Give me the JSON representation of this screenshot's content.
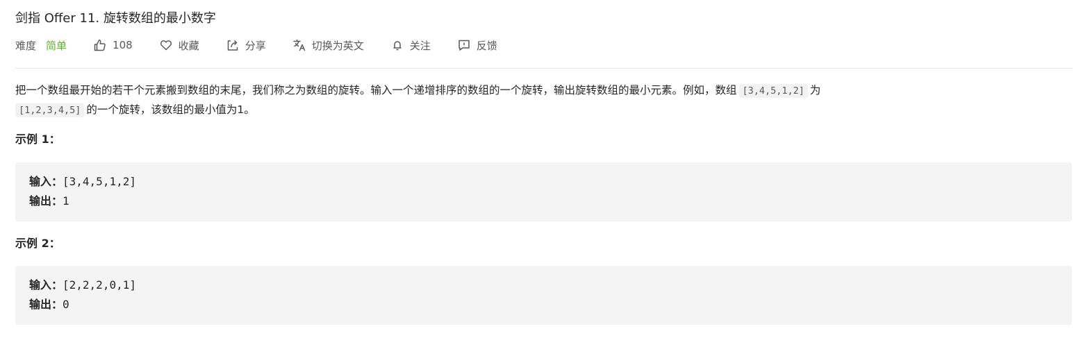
{
  "problem": {
    "title": "剑指 Offer 11. 旋转数组的最小数字"
  },
  "meta": {
    "difficulty_label": "难度",
    "difficulty_value": "简单",
    "difficulty_color": "#5ab726",
    "likes": "108",
    "favorite_label": "收藏",
    "share_label": "分享",
    "switch_lang_label": "切换为英文",
    "follow_label": "关注",
    "feedback_label": "反馈",
    "icons": [
      "thumbs-up-icon",
      "heart-icon",
      "share-icon",
      "translate-icon",
      "bell-icon",
      "feedback-icon"
    ]
  },
  "description": {
    "part1": "把一个数组最开始的若干个元素搬到数组的末尾，我们称之为数组的旋转。输入一个递增排序的数组的一个旋转，输出旋转数组的最小元素。例如，数组",
    "code1": "[3,4,5,1,2]",
    "part2": "为",
    "code2": "[1,2,3,4,5]",
    "part3": "的一个旋转，该数组的最小值为1。"
  },
  "examples": [
    {
      "title": "示例 1：",
      "input_label": "输入：",
      "input_value": "[3,4,5,1,2]",
      "output_label": "输出：",
      "output_value": "1"
    },
    {
      "title": "示例 2：",
      "input_label": "输入：",
      "input_value": "[2,2,2,0,1]",
      "output_label": "输出：",
      "output_value": "0"
    }
  ]
}
